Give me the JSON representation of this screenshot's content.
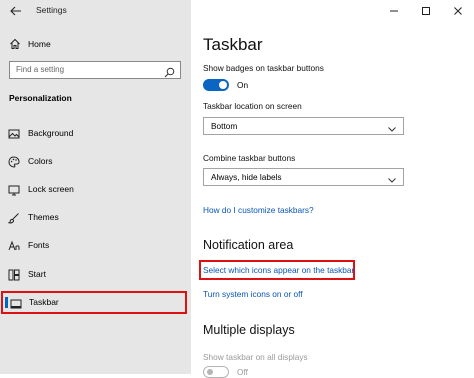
{
  "window": {
    "title": "Settings",
    "controls": [
      "minimize-icon",
      "maximize-icon",
      "close-icon"
    ]
  },
  "sidebar": {
    "home_label": "Home",
    "search_placeholder": "Find a setting",
    "section_heading": "Personalization",
    "items": [
      {
        "label": "Background",
        "icon": "picture-icon"
      },
      {
        "label": "Colors",
        "icon": "palette-icon"
      },
      {
        "label": "Lock screen",
        "icon": "lock-screen-icon"
      },
      {
        "label": "Themes",
        "icon": "brush-icon"
      },
      {
        "label": "Fonts",
        "icon": "font-icon"
      },
      {
        "label": "Start",
        "icon": "start-grid-icon"
      },
      {
        "label": "Taskbar",
        "icon": "taskbar-icon",
        "selected": true
      }
    ]
  },
  "main": {
    "title": "Taskbar",
    "badges": {
      "label": "Show badges on taskbar buttons",
      "state": "On"
    },
    "location": {
      "label": "Taskbar location on screen",
      "value": "Bottom"
    },
    "combine": {
      "label": "Combine taskbar buttons",
      "value": "Always, hide labels"
    },
    "customize_link": "How do I customize taskbars?",
    "notification": {
      "title": "Notification area",
      "link_icons": "Select which icons appear on the taskbar",
      "link_system": "Turn system icons on or off"
    },
    "multiple_displays": {
      "title": "Multiple displays",
      "show_on_all": "Show taskbar on all displays",
      "state": "Off"
    }
  },
  "colors": {
    "sidebar_bg": "#e6e6e6",
    "accent": "#0a66c2",
    "highlight_box": "#d11111",
    "link": "#0a55b6"
  }
}
